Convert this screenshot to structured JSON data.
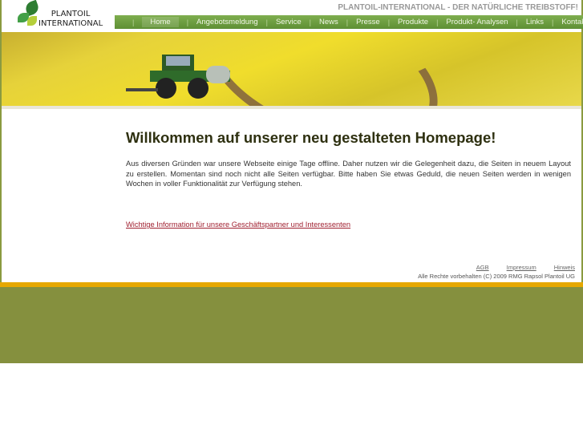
{
  "logo": {
    "line1": "PLANTOIL",
    "line2": "INTERNATIONAL"
  },
  "slogan": "PLANTOIL-INTERNATIONAL - DER NATÜRLICHE TREIBSTOFF!",
  "nav": [
    "Home",
    "Angebotsmeldung",
    "Service",
    "News",
    "Presse",
    "Produkte",
    "Produkt- Analysen",
    "Links",
    "Kontakt"
  ],
  "main": {
    "title": "Willkommen auf unserer neu gestalteten Homepage!",
    "intro": "Aus diversen Gründen war unsere Webseite einige Tage offline. Daher nutzen wir die Gelegenheit dazu, die Seiten in neuem Layout zu erstellen. Momentan sind noch nicht alle Seiten verfügbar. Bitte haben Sie etwas Geduld, die neuen Seiten werden in wenigen Wochen in voller Funktionalität  zur Verfügung stehen.",
    "info_link": "Wichtige Information für unsere Geschäftspartner und Interessenten"
  },
  "footer": {
    "links": [
      "AGB",
      "Impressum",
      "Hinweis"
    ],
    "copyright": "Alle Rechte vorbehalten (C) 2009 RMG Rapsol Plantoil UG"
  }
}
